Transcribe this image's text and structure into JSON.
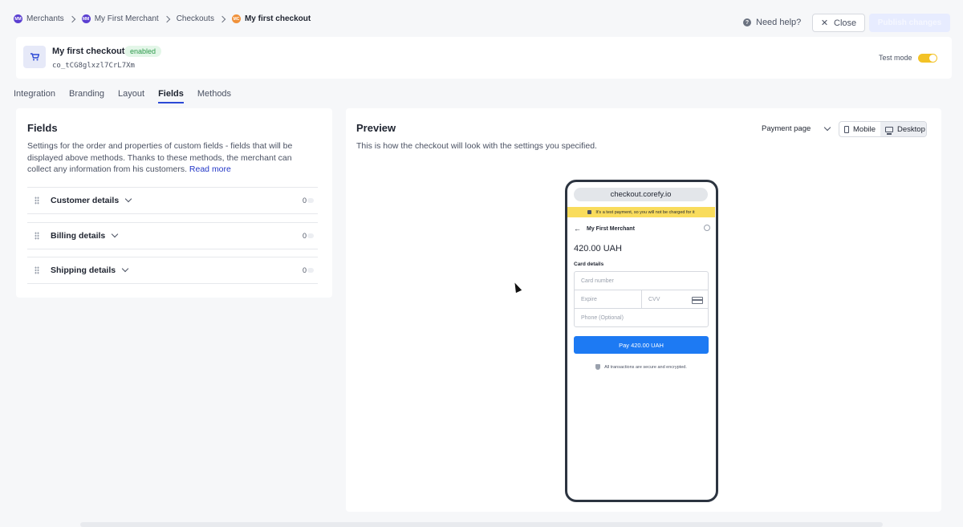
{
  "breadcrumbs": [
    {
      "label": "Merchants",
      "badge": "MM",
      "badge_color": "#5b3fd1"
    },
    {
      "label": "My First Merchant",
      "badge": "MM",
      "badge_color": "#5b3fd1"
    },
    {
      "label": "Checkouts"
    },
    {
      "label": "My first checkout",
      "badge": "MC",
      "badge_color": "#f0913a"
    }
  ],
  "topbar": {
    "help_label": "Need help?",
    "close_label": "Close",
    "publish_label": "Publish changes"
  },
  "checkout": {
    "title": "My first checkout",
    "status": "enabled",
    "id": "co_tCG8glxzl7CrL7Xm",
    "test_mode_label": "Test mode",
    "test_mode_on": true
  },
  "tabs": [
    {
      "label": "Integration",
      "active": false
    },
    {
      "label": "Branding",
      "active": false
    },
    {
      "label": "Layout",
      "active": false
    },
    {
      "label": "Fields",
      "active": true
    },
    {
      "label": "Methods",
      "active": false
    }
  ],
  "fields": {
    "title": "Fields",
    "description": "Settings for the order and properties of custom fields - fields that will be displayed above methods. Thanks to these methods, the merchant can collect any information from his customers.",
    "read_more": "Read more",
    "sections": [
      {
        "label": "Customer details",
        "count": "0"
      },
      {
        "label": "Billing details",
        "count": "0"
      },
      {
        "label": "Shipping details",
        "count": "0"
      }
    ]
  },
  "preview": {
    "title": "Preview",
    "description": "This is how the checkout will look with the settings you specified.",
    "page_select": "Payment page",
    "device_mobile": "Mobile",
    "device_desktop": "Desktop",
    "phone": {
      "url": "checkout.corefy.io",
      "test_banner": "It's a test payment, so you will not be charged for it",
      "merchant": "My First Merchant",
      "amount": "420.00 UAH",
      "card_details_label": "Card details",
      "card_number_placeholder": "Card number",
      "expire_placeholder": "Expire",
      "cvv_placeholder": "CVV",
      "phone_placeholder": "Phone (Optional)",
      "pay_label": "Pay 420.00 UAH",
      "secure_note": "All transactions are secure and encrypted."
    }
  },
  "colors": {
    "accent": "#2b49d6",
    "pay_button": "#1d7af3",
    "test_banner": "#f9dc5c",
    "toggle": "#f3c226"
  }
}
